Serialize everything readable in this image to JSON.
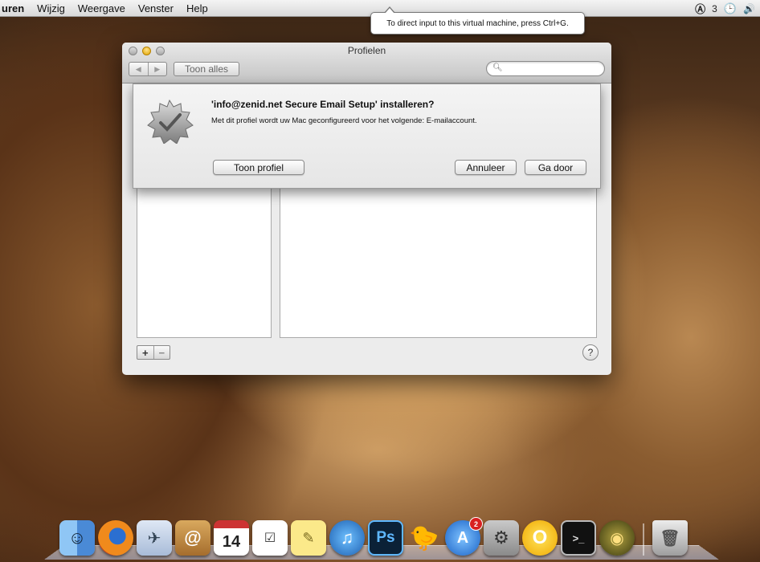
{
  "menubar": {
    "items": [
      "uren",
      "Wijzig",
      "Weergave",
      "Venster",
      "Help"
    ],
    "right": {
      "adobe": "3",
      "clock_icon": "clock-icon",
      "volume_icon": "volume-icon"
    }
  },
  "tooltip": {
    "text": "To direct input to this virtual machine, press Ctrl+G."
  },
  "window": {
    "title": "Profielen",
    "show_all": "Toon alles",
    "nav_back": "◀",
    "nav_forward": "▶",
    "search_placeholder": "",
    "add_label": "+",
    "remove_label": "−",
    "help_label": "?"
  },
  "sheet": {
    "title": "'info@zenid.net Secure Email Setup' installeren?",
    "message": "Met dit profiel wordt uw Mac geconfigureerd voor het volgende: E-mailaccount.",
    "show_profile": "Toon profiel",
    "cancel": "Annuleer",
    "continue": "Ga door"
  },
  "dock": {
    "calendar_day": "14",
    "app_store_badge": "2",
    "photoshop_label": "Ps"
  }
}
